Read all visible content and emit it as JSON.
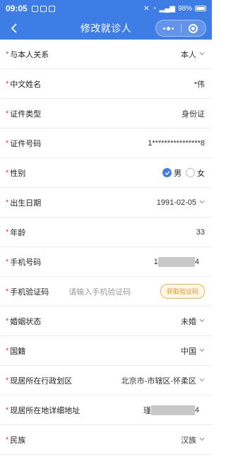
{
  "status_bar": {
    "time": "09:05",
    "battery": "98%"
  },
  "nav": {
    "title": "修改就诊人"
  },
  "form": {
    "relation": {
      "label": "与本人关系",
      "value": "本人"
    },
    "name": {
      "label": "中文姓名",
      "value": "*伟"
    },
    "id_type": {
      "label": "证件类型",
      "value": "身份证"
    },
    "id_number": {
      "label": "证件号码",
      "value": "1****************8"
    },
    "gender": {
      "label": "性别",
      "options": [
        "男",
        "女"
      ],
      "selected": "男"
    },
    "birthdate": {
      "label": "出生日期",
      "value": "1991-02-05"
    },
    "age": {
      "label": "年龄",
      "value": "33"
    },
    "phone": {
      "label": "手机号码",
      "prefix": "1",
      "suffix": "4"
    },
    "sms_code": {
      "label": "手机验证码",
      "placeholder": "请输入手机验证码",
      "button": "获取验证码"
    },
    "marital": {
      "label": "婚姻状态",
      "value": "未婚"
    },
    "nationality": {
      "label": "国籍",
      "value": "中国"
    },
    "district": {
      "label": "现居所在行政划区",
      "value": "北京市-市辖区-怀柔区"
    },
    "address": {
      "label": "现居所在地详细地址",
      "prefix": "瑾",
      "suffix": "4"
    },
    "ethnicity": {
      "label": "民族",
      "value": "汉族"
    }
  },
  "colors": {
    "primary": "#3f7de6",
    "required": "#e03c3c",
    "code_button": "#e39520"
  }
}
